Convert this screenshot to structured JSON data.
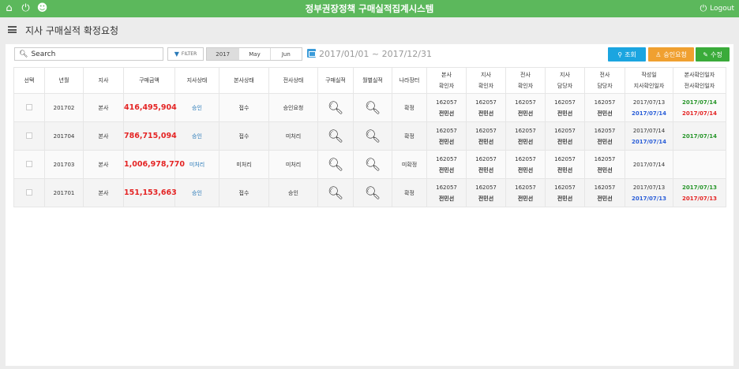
{
  "topbar": {
    "title": "정부권장정책 구매실적집계시스템",
    "logout": "Logout",
    "icons": [
      "home-icon",
      "power-icon",
      "users-icon"
    ]
  },
  "header": {
    "title": "지사 구매실적 확정요청"
  },
  "toolbar": {
    "search_placeholder": "Search",
    "filter_label": "FILTER",
    "periods": [
      "2017",
      "May",
      "Jun"
    ],
    "date_range": "2017/01/01 ~ 2017/12/31",
    "btn_search": "조회",
    "btn_approve": "승인요청",
    "btn_edit": "수정"
  },
  "table": {
    "headers": [
      "선택",
      "년월",
      "지사",
      "구매금액",
      "지사상태",
      "본사상태",
      "전사상태",
      "구매실적",
      "월별실적",
      "나라장터",
      "본사\n확인자",
      "지사\n확인자",
      "전사\n확인자",
      "지사\n담당자",
      "전사\n담당자",
      "작성일\n지사확인일자",
      "본사확인일자\n전사확인일자"
    ],
    "rows": [
      {
        "ym": "201702",
        "branch": "본사",
        "amount": "416,495,904",
        "branch_status": "승인",
        "hq_status": "접수",
        "corp_status": "승인요청",
        "nara": "확정",
        "hq_confirm": [
          "162057",
          "전민선"
        ],
        "branch_confirm": [
          "162057",
          "전민선"
        ],
        "corp_confirm": [
          "162057",
          "전민선"
        ],
        "branch_mgr": [
          "162057",
          "전민선"
        ],
        "corp_mgr": [
          "162057",
          "전민선"
        ],
        "created": "2017/07/13",
        "branch_date": "2017/07/14",
        "hq_date": "2017/07/14",
        "corp_date": "2017/07/14"
      },
      {
        "ym": "201704",
        "branch": "본사",
        "amount": "786,715,094",
        "branch_status": "승인",
        "hq_status": "접수",
        "corp_status": "미처리",
        "nara": "확정",
        "hq_confirm": [
          "162057",
          "전민선"
        ],
        "branch_confirm": [
          "162057",
          "전민선"
        ],
        "corp_confirm": [
          "162057",
          "전민선"
        ],
        "branch_mgr": [
          "162057",
          "전민선"
        ],
        "corp_mgr": [
          "162057",
          "전민선"
        ],
        "created": "2017/07/14",
        "branch_date": "2017/07/14",
        "hq_date": "2017/07/14",
        "corp_date": ""
      },
      {
        "ym": "201703",
        "branch": "본사",
        "amount": "1,006,978,770",
        "branch_status": "미처리",
        "hq_status": "미처리",
        "corp_status": "미처리",
        "nara": "미확정",
        "hq_confirm": [
          "162057",
          "전민선"
        ],
        "branch_confirm": [
          "162057",
          "전민선"
        ],
        "corp_confirm": [
          "162057",
          "전민선"
        ],
        "branch_mgr": [
          "162057",
          "전민선"
        ],
        "corp_mgr": [
          "162057",
          "전민선"
        ],
        "created": "2017/07/14",
        "branch_date": "",
        "hq_date": "",
        "corp_date": ""
      },
      {
        "ym": "201701",
        "branch": "본사",
        "amount": "151,153,663",
        "branch_status": "승인",
        "hq_status": "접수",
        "corp_status": "승인",
        "nara": "확정",
        "hq_confirm": [
          "162057",
          "전민선"
        ],
        "branch_confirm": [
          "162057",
          "전민선"
        ],
        "corp_confirm": [
          "162057",
          "전민선"
        ],
        "branch_mgr": [
          "162057",
          "전민선"
        ],
        "corp_mgr": [
          "162057",
          "전민선"
        ],
        "created": "2017/07/13",
        "branch_date": "2017/07/13",
        "hq_date": "2017/07/13",
        "corp_date": "2017/07/13"
      }
    ]
  }
}
